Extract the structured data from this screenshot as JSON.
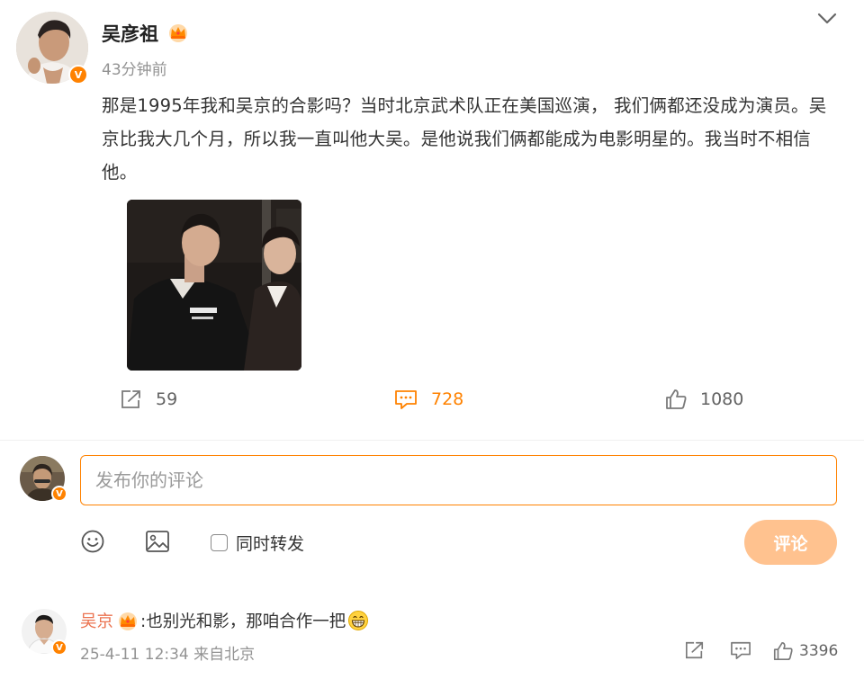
{
  "post": {
    "author": "吴彦祖",
    "time": "43分钟前",
    "text": "那是1995年我和吴京的合影吗？当时北京武术队正在美国巡演， 我们俩都还没成为演员。吴京比我大几个月，所以我一直叫他大吴。是他说我们俩都能成为电影明星的。我当时不相信他。",
    "verified_badge": "V",
    "photo_icon": "photo-two-young-men",
    "actions": {
      "repost_count": "59",
      "comment_count": "728",
      "like_count": "1080"
    }
  },
  "composer": {
    "placeholder": "发布你的评论",
    "repost_label": "同时转发",
    "submit_label": "评论",
    "verified_badge": "V"
  },
  "comment": {
    "author": "吴京",
    "text": ":也别光和影，那咱合作一把",
    "emoji": "grinning-face",
    "meta": "25-4-11 12:34 来自北京",
    "like_count": "3396",
    "verified_badge": "V"
  },
  "colors": {
    "accent": "#ff8200",
    "author_link": "#eb7350",
    "submit_disabled": "#ffc28f",
    "muted": "#939393"
  },
  "icons": {
    "crown": "crown-icon",
    "chevron": "chevron-down-icon",
    "repost": "share-icon",
    "comment": "comment-icon",
    "like": "thumbs-up-icon",
    "emoji": "emoji-icon",
    "image": "image-icon"
  }
}
